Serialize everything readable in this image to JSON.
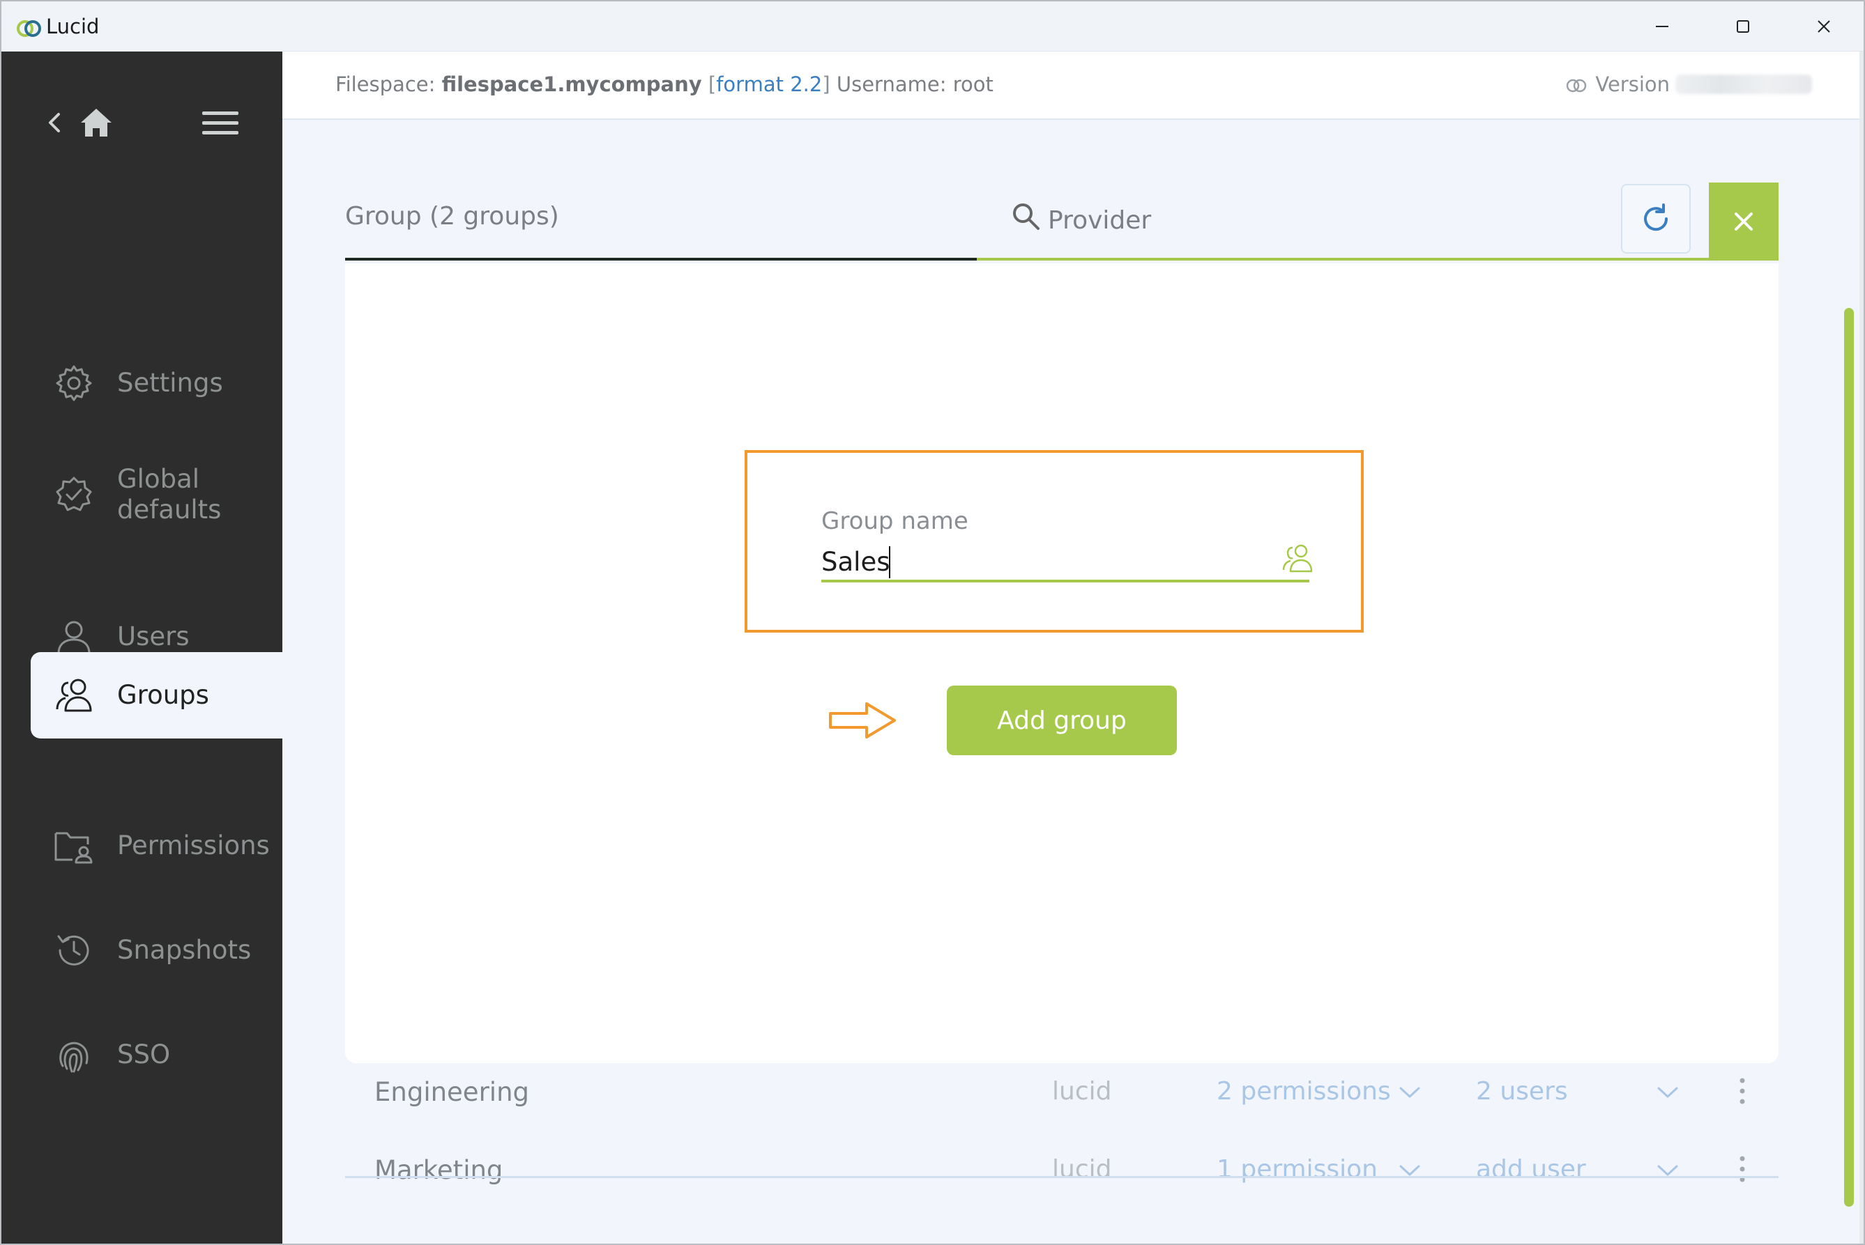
{
  "window": {
    "title": "Lucid"
  },
  "sidebar": {
    "items": [
      {
        "label": "Settings",
        "icon": "gear-icon"
      },
      {
        "label": "Global defaults",
        "label_line1": "Global",
        "label_line2": "defaults",
        "icon": "badge-check-icon"
      },
      {
        "label": "Users",
        "icon": "user-icon"
      },
      {
        "label": "Groups",
        "icon": "group-icon",
        "active": true
      },
      {
        "label": "Permissions",
        "icon": "folder-user-icon"
      },
      {
        "label": "Snapshots",
        "icon": "history-icon"
      },
      {
        "label": "SSO",
        "icon": "fingerprint-icon"
      }
    ]
  },
  "topbar": {
    "filespace_label": "Filespace:",
    "filespace_name": "filespace1.mycompany",
    "format_open": "[",
    "format_text": "format 2.2",
    "format_close": "]",
    "username_text": "Username: root",
    "version_label": "Version"
  },
  "tabs": {
    "group_label": "Group (2 groups)",
    "provider_label": "Provider"
  },
  "form": {
    "field_label": "Group name",
    "field_value": "Sales",
    "add_button_label": "Add group"
  },
  "groups": [
    {
      "name": "Engineering",
      "provider": "lucid",
      "permissions": "2 permissions",
      "users": "2 users"
    },
    {
      "name": "Marketing",
      "provider": "lucid",
      "permissions": "1 permission",
      "users": "add user"
    }
  ],
  "colors": {
    "accent_green": "#a6c94b",
    "sidebar_bg": "#2c2d2c",
    "highlight_orange": "#f29a2e",
    "link_blue": "#3a7fc1"
  }
}
